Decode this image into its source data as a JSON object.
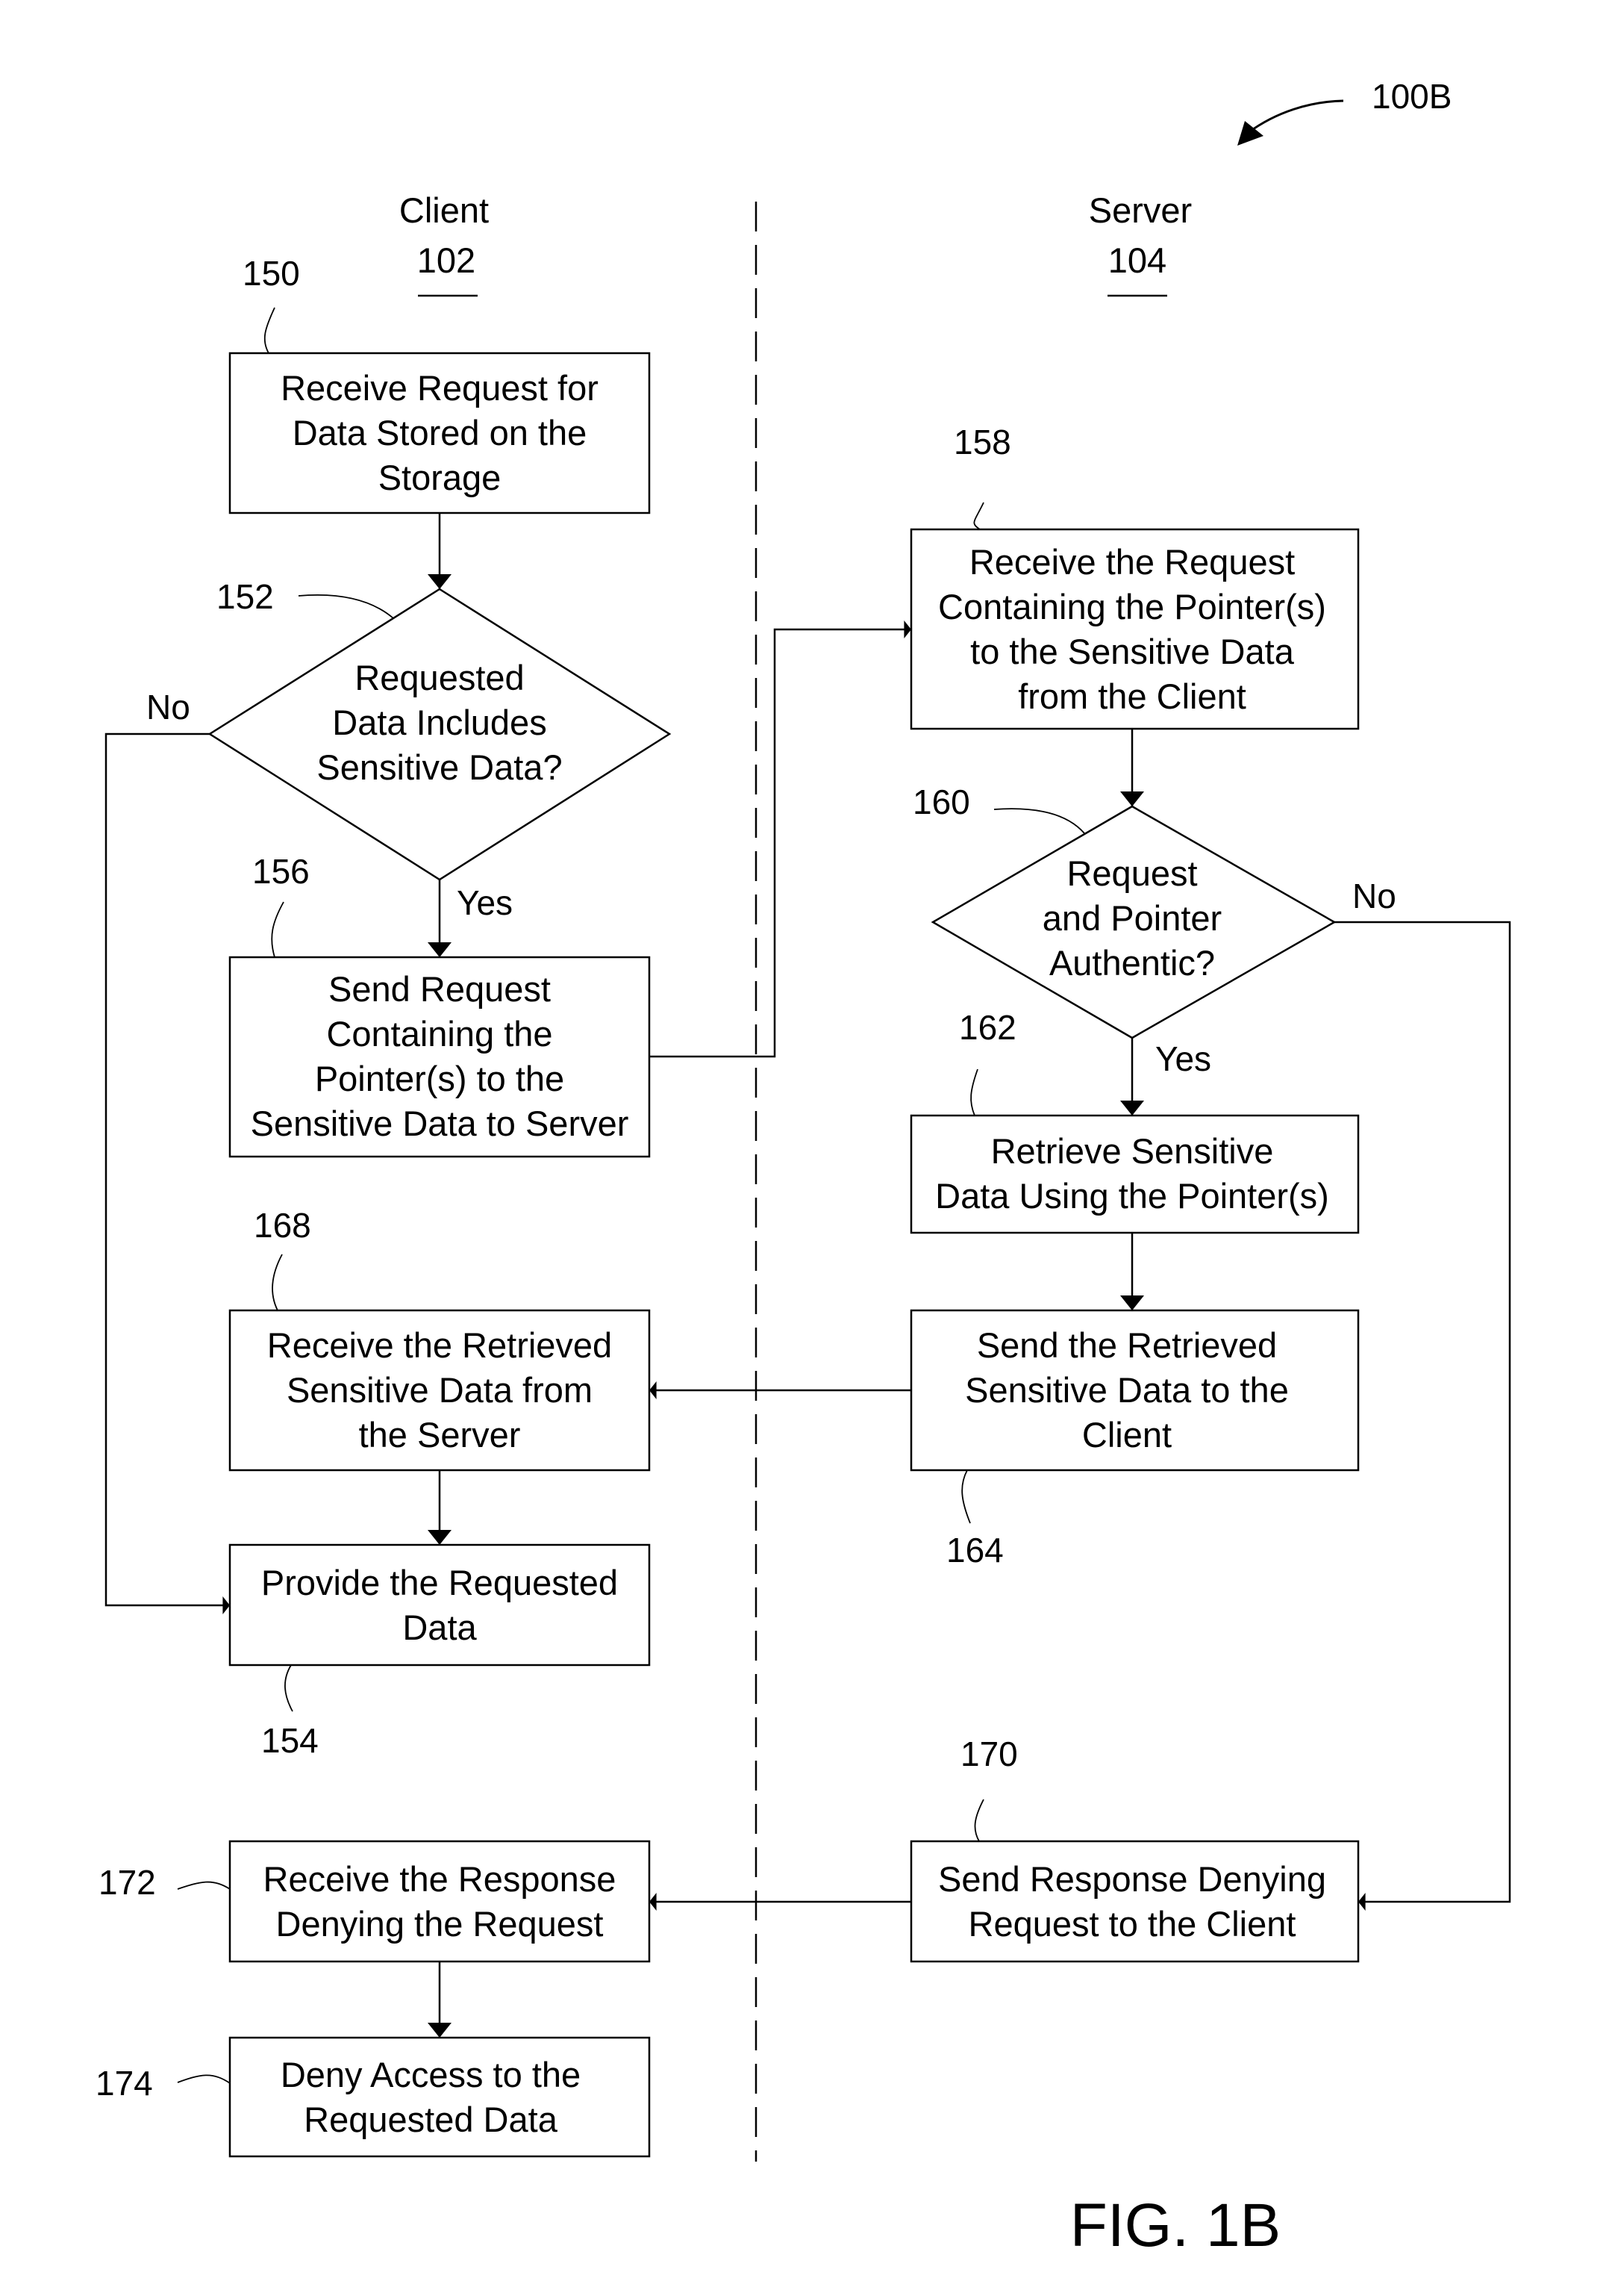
{
  "figure": {
    "label": "FIG. 1B",
    "reference": "100B"
  },
  "lanes": [
    {
      "name": "Client",
      "ref": "102"
    },
    {
      "name": "Server",
      "ref": "104"
    }
  ],
  "nodes": {
    "n150": {
      "ref": "150",
      "type": "process",
      "lines": [
        "Receive Request for",
        "Data Stored on the",
        "Storage"
      ]
    },
    "n152": {
      "ref": "152",
      "type": "decision",
      "lines": [
        "Requested",
        "Data Includes",
        "Sensitive Data?"
      ]
    },
    "n156": {
      "ref": "156",
      "type": "process",
      "lines": [
        "Send Request",
        "Containing the",
        "Pointer(s) to the",
        "Sensitive Data to Server"
      ]
    },
    "n158": {
      "ref": "158",
      "type": "process",
      "lines": [
        "Receive the Request",
        "Containing the Pointer(s)",
        "to the Sensitive Data",
        "from the Client"
      ]
    },
    "n160": {
      "ref": "160",
      "type": "decision",
      "lines": [
        "Request",
        "and Pointer",
        "Authentic?"
      ]
    },
    "n162": {
      "ref": "162",
      "type": "process",
      "lines": [
        "Retrieve Sensitive",
        "Data Using the Pointer(s)"
      ]
    },
    "n164": {
      "ref": "164",
      "type": "process",
      "lines": [
        "Send the Retrieved",
        "Sensitive Data to the",
        "Client"
      ]
    },
    "n168": {
      "ref": "168",
      "type": "process",
      "lines": [
        "Receive the Retrieved",
        "Sensitive Data from",
        "the Server"
      ]
    },
    "n154": {
      "ref": "154",
      "type": "process",
      "lines": [
        "Provide the Requested",
        "Data"
      ]
    },
    "n170": {
      "ref": "170",
      "type": "process",
      "lines": [
        "Send Response Denying",
        "Request to the Client"
      ]
    },
    "n172": {
      "ref": "172",
      "type": "process",
      "lines": [
        "Receive the Response",
        "Denying the Request"
      ]
    },
    "n174": {
      "ref": "174",
      "type": "process",
      "lines": [
        "Deny Access to the",
        "Requested Data"
      ]
    }
  },
  "edges": [
    {
      "from": "150",
      "to": "152",
      "label": ""
    },
    {
      "from": "152",
      "to": "156",
      "label": "Yes"
    },
    {
      "from": "152",
      "to": "154",
      "label": "No"
    },
    {
      "from": "156",
      "to": "158",
      "label": ""
    },
    {
      "from": "158",
      "to": "160",
      "label": ""
    },
    {
      "from": "160",
      "to": "162",
      "label": "Yes"
    },
    {
      "from": "160",
      "to": "170",
      "label": "No"
    },
    {
      "from": "162",
      "to": "164",
      "label": ""
    },
    {
      "from": "164",
      "to": "168",
      "label": ""
    },
    {
      "from": "168",
      "to": "154",
      "label": ""
    },
    {
      "from": "170",
      "to": "172",
      "label": ""
    },
    {
      "from": "172",
      "to": "174",
      "label": ""
    }
  ],
  "branch_labels": {
    "d152_no": "No",
    "d152_yes": "Yes",
    "d160_no": "No",
    "d160_yes": "Yes"
  }
}
